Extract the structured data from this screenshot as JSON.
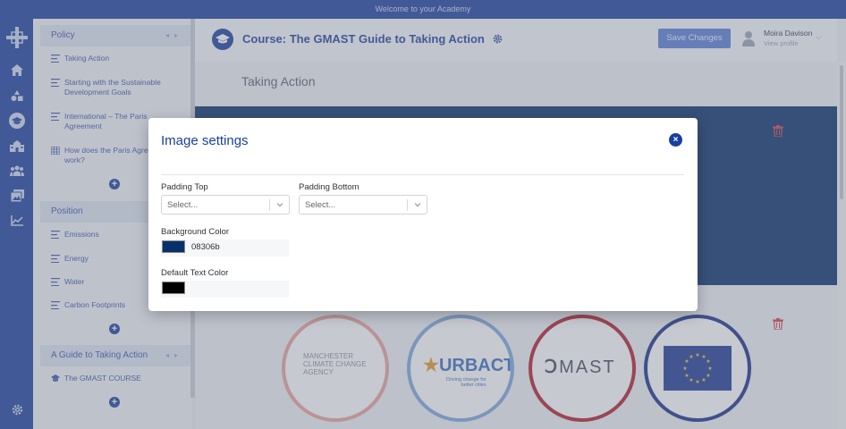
{
  "topbar": {
    "text": "Welcome to your Academy"
  },
  "rail": {
    "icons": [
      "home-icon",
      "shapes-icon",
      "graduation-cap-icon",
      "school-icon",
      "users-icon",
      "gallery-icon",
      "chart-line-icon",
      "gear-icon"
    ]
  },
  "panel": {
    "sections": [
      {
        "title": "Policy",
        "items": [
          {
            "label": "Taking Action"
          },
          {
            "label": "Starting with the Sustainable Development Goals"
          },
          {
            "label": "International – The Paris Agreement"
          },
          {
            "label": "How does the Paris Agreement work?"
          }
        ]
      },
      {
        "title": "Position",
        "items": [
          {
            "label": "Emissions"
          },
          {
            "label": "Energy"
          },
          {
            "label": "Water"
          },
          {
            "label": "Carbon Footprints"
          }
        ]
      },
      {
        "title": "A Guide to Taking Action",
        "items": [
          {
            "label": "The GMAST COURSE"
          }
        ]
      }
    ],
    "plus_label": "+"
  },
  "main": {
    "course_title": "Course:  The GMAST Guide to Taking Action",
    "save_label": "Save Changes",
    "user_name": "Moira Davison",
    "user_link": "View profile",
    "page_title": "Taking Action",
    "logos": {
      "manchester": [
        "MANCHESTER",
        "CLIMATE CHANGE",
        "AGENCY"
      ],
      "urbact_name": "URBACT",
      "urbact_tagline": [
        "Driving change for",
        "better cities"
      ],
      "gmast": "MAST"
    }
  },
  "modal": {
    "title": "Image settings",
    "close_label": "×",
    "padding_top_label": "Padding Top",
    "padding_top_placeholder": "Select...",
    "padding_bottom_label": "Padding Bottom",
    "padding_bottom_placeholder": "Select...",
    "bg_color_label": "Background Color",
    "bg_color_value": "08306b",
    "text_color_label": "Default Text Color",
    "text_color_value": ""
  },
  "colors": {
    "brand": "#1a3f9e",
    "background_swatch": "#08306b",
    "text_swatch": "#000000"
  }
}
